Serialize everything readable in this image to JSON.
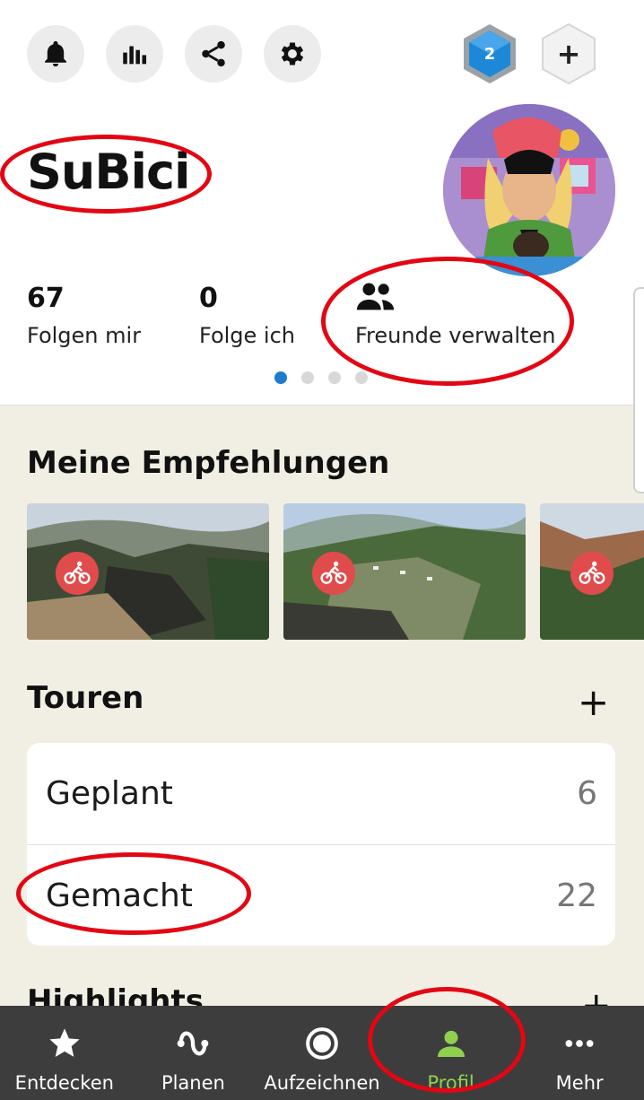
{
  "header": {
    "icons": [
      "bell-icon",
      "stats-icon",
      "share-icon",
      "settings-icon"
    ],
    "level_badge": "2"
  },
  "profile": {
    "username": "SuBici"
  },
  "stats": {
    "followers_count": "67",
    "followers_label": "Folgen mir",
    "following_count": "0",
    "following_label": "Folge ich",
    "friends_label": "Freunde verwalten"
  },
  "recommendations": {
    "title": "Meine Empfehlungen"
  },
  "tours": {
    "title": "Touren",
    "rows": [
      {
        "label": "Geplant",
        "count": "6"
      },
      {
        "label": "Gemacht",
        "count": "22"
      }
    ]
  },
  "highlights": {
    "title": "Highlights"
  },
  "nav": {
    "items": [
      {
        "label": "Entdecken",
        "icon": "star-icon"
      },
      {
        "label": "Planen",
        "icon": "route-icon"
      },
      {
        "label": "Aufzeichnen",
        "icon": "record-icon"
      },
      {
        "label": "Profil",
        "icon": "person-icon"
      },
      {
        "label": "Mehr",
        "icon": "more-icon"
      }
    ]
  },
  "colors": {
    "accent_blue": "#1f7bd0",
    "active_green": "#8fd14f",
    "annotation_red": "#e30613",
    "bike_badge_red": "#e04b4b"
  }
}
